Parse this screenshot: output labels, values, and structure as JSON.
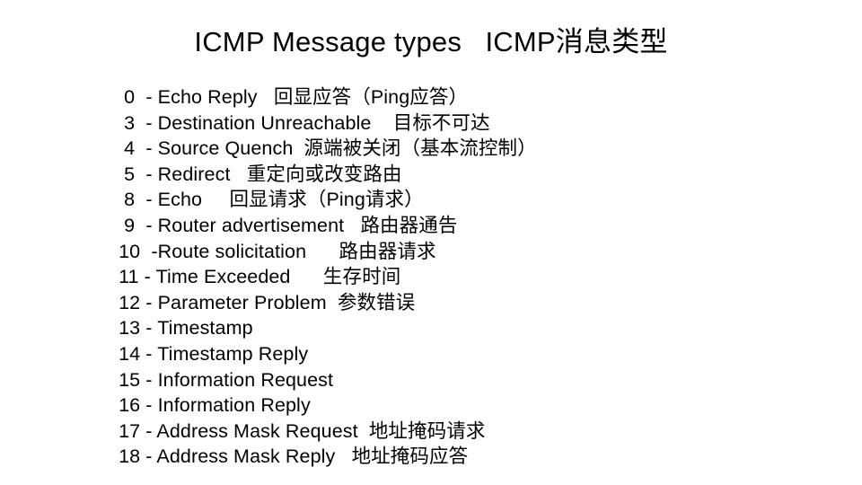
{
  "slide": {
    "title": "ICMP Message types   ICMP消息类型",
    "background_color": "#ffffff",
    "text_color": "#000000",
    "lines": [
      {
        "text": "  0  - Echo Reply   回显应答（Ping应答）",
        "code": "0",
        "english": "Echo Reply",
        "chinese": "回显应答（Ping应答）"
      },
      {
        "text": "  3  - Destination Unreachable    目标不可达",
        "code": "3",
        "english": "Destination Unreachable",
        "chinese": "目标不可达"
      },
      {
        "text": "  4  - Source Quench  源端被关闭（基本流控制）",
        "code": "4",
        "english": "Source Quench",
        "chinese": "源端被关闭（基本流控制）"
      },
      {
        "text": "  5  - Redirect   重定向或改变路由",
        "code": "5",
        "english": "Redirect",
        "chinese": "重定向或改变路由"
      },
      {
        "text": "  8  - Echo     回显请求（Ping请求）",
        "code": "8",
        "english": "Echo",
        "chinese": "回显请求（Ping请求）"
      },
      {
        "text": "  9  - Router advertisement   路由器通告",
        "code": "9",
        "english": "Router advertisement",
        "chinese": "路由器通告"
      },
      {
        "text": " 10  -Route solicitation      路由器请求",
        "code": "10",
        "english": "Route solicitation",
        "chinese": "路由器请求"
      },
      {
        "text": " 11 - Time Exceeded      生存时间",
        "code": "11",
        "english": "Time Exceeded",
        "chinese": "生存时间"
      },
      {
        "text": " 12 - Parameter Problem  参数错误",
        "code": "12",
        "english": "Parameter Problem",
        "chinese": "参数错误"
      },
      {
        "text": " 13 - Timestamp",
        "code": "13",
        "english": "Timestamp",
        "chinese": ""
      },
      {
        "text": " 14 - Timestamp Reply",
        "code": "14",
        "english": "Timestamp Reply",
        "chinese": ""
      },
      {
        "text": " 15 - Information Request",
        "code": "15",
        "english": "Information Request",
        "chinese": ""
      },
      {
        "text": " 16 - Information Reply",
        "code": "16",
        "english": "Information Reply",
        "chinese": ""
      },
      {
        "text": " 17 - Address Mask Request  地址掩码请求",
        "code": "17",
        "english": "Address Mask Request",
        "chinese": "地址掩码请求"
      },
      {
        "text": " 18 - Address Mask Reply   地址掩码应答",
        "code": "18",
        "english": "Address Mask Reply",
        "chinese": "地址掩码应答"
      }
    ]
  }
}
